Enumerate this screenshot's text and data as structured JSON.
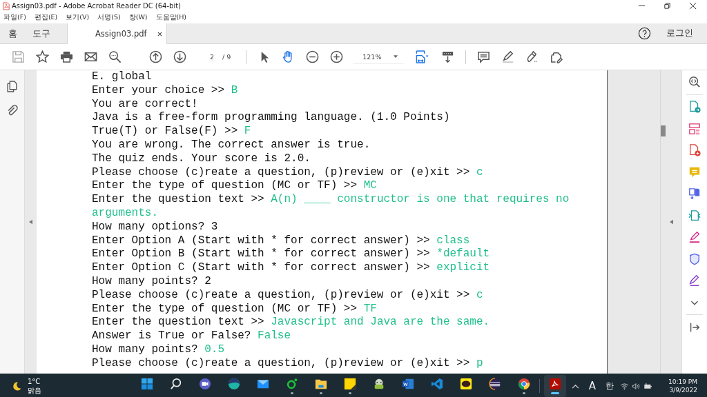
{
  "window": {
    "title": "Assign03.pdf - Adobe Acrobat Reader DC (64-bit)"
  },
  "menu": [
    "파일(F)",
    "편집(E)",
    "보기(V)",
    "서명(S)",
    "창(W)",
    "도움말(H)"
  ],
  "tabs": [
    {
      "label": "홈",
      "kind": "nav",
      "selected": false
    },
    {
      "label": "도구",
      "kind": "nav",
      "selected": false
    },
    {
      "label": "Assign03.pdf",
      "kind": "document",
      "selected": true
    }
  ],
  "account": {
    "login": "로그인"
  },
  "toolbar": {
    "page": "2",
    "page_total": "/ 9",
    "zoom": "121%"
  },
  "console": [
    {
      "prompt": "E. global"
    },
    {
      "prompt": "Enter your choice >>",
      "input": "B"
    },
    {
      "prompt": "You are correct!"
    },
    {
      "prompt": "Java is a free-form programming language. (1.0 Points)"
    },
    {
      "prompt": "True(T) or False(F) >>",
      "input": "F"
    },
    {
      "prompt": "You are wrong. The correct answer is true."
    },
    {
      "prompt": "The quiz ends. Your score is 2.0."
    },
    {
      "prompt": "Please choose (c)reate a question, (p)review or (e)xit >>",
      "input": "c"
    },
    {
      "prompt": "Enter the type of question (MC or TF) >>",
      "input": "MC"
    },
    {
      "prompt": "Enter the question text >>",
      "input": "A(n) ____ constructor is one that requires no arguments."
    },
    {
      "prompt": "How many options? 3"
    },
    {
      "prompt": "Enter Option A (Start with * for correct answer) >>",
      "input": "class"
    },
    {
      "prompt": "Enter Option B (Start with * for correct answer) >>",
      "input": "*default"
    },
    {
      "prompt": "Enter Option C (Start with * for correct answer) >>",
      "input": "explicit"
    },
    {
      "prompt": "How many points? 2"
    },
    {
      "prompt": "Please choose (c)reate a question, (p)review or (e)xit >>",
      "input": "c"
    },
    {
      "prompt": "Enter the type of question (MC or TF) >>",
      "input": "TF"
    },
    {
      "prompt": "Enter the question text >>",
      "input": "Javascript and Java are the same."
    },
    {
      "prompt": "Answer is True or False?",
      "input": "False"
    },
    {
      "prompt": "How many points?",
      "input": "0.5"
    },
    {
      "prompt": "Please choose (c)reate a question, (p)review or (e)xit >>",
      "input": "p"
    }
  ],
  "taskbar": {
    "temperature": "1°C",
    "weather": "맑음",
    "apps": [
      {
        "kind": "start",
        "running": false,
        "active": false
      },
      {
        "kind": "search",
        "running": false,
        "active": false
      },
      {
        "kind": "chat",
        "running": false,
        "active": false
      },
      {
        "kind": "whale",
        "running": false,
        "active": false
      },
      {
        "kind": "mail",
        "running": false,
        "active": false
      },
      {
        "kind": "line",
        "running": true,
        "active": false
      },
      {
        "kind": "explorer",
        "running": true,
        "active": false
      },
      {
        "kind": "sticky",
        "running": true,
        "active": false
      },
      {
        "kind": "game",
        "running": false,
        "active": false
      },
      {
        "kind": "word",
        "running": false,
        "active": false
      },
      {
        "kind": "vscode",
        "running": false,
        "active": false
      },
      {
        "kind": "talk",
        "running": false,
        "active": false
      },
      {
        "kind": "eclipse",
        "running": false,
        "active": false
      },
      {
        "kind": "chrome",
        "running": true,
        "active": false
      },
      {
        "kind": "acrobat",
        "running": true,
        "active": true
      }
    ],
    "input_mode": "A",
    "ime": "한",
    "time": "10:19 PM",
    "date": "3/9/2022"
  }
}
